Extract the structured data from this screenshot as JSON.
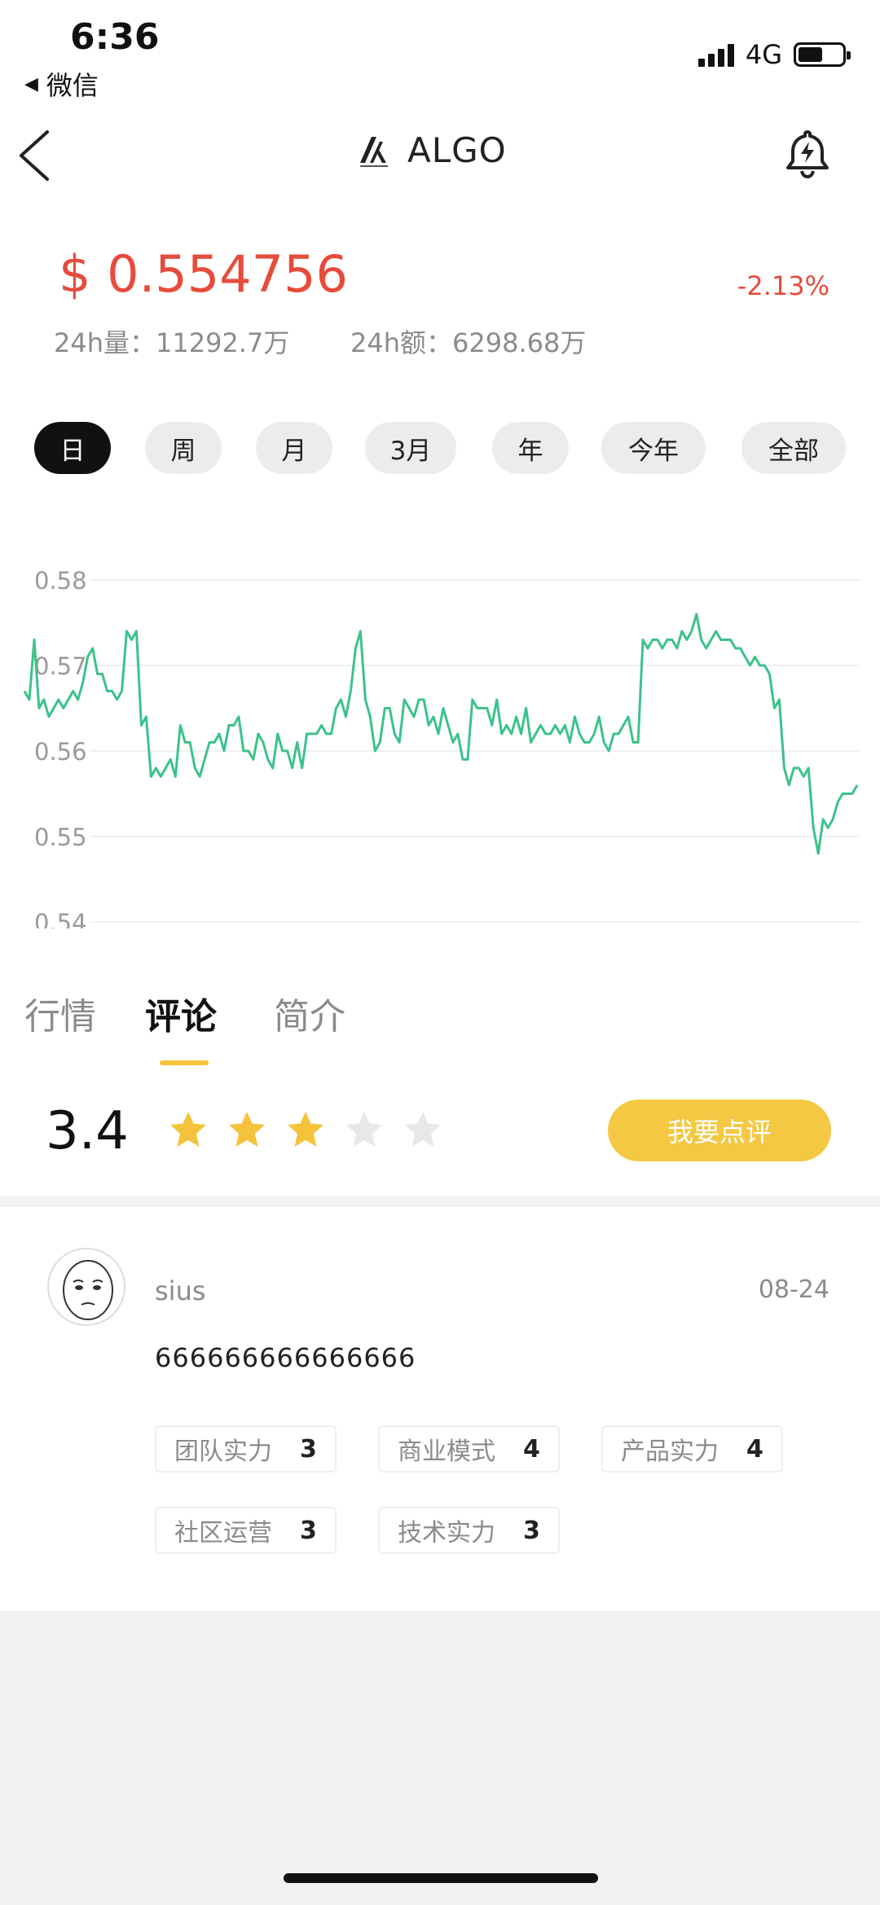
{
  "status_bar": {
    "time": "6:36",
    "back_app": "微信",
    "network": "4G"
  },
  "header": {
    "title": "ALGO",
    "back_icon": "back-chevron-icon",
    "logo_icon": "algo-logo-icon",
    "alert_icon": "bell-lightning-icon"
  },
  "price": {
    "value": "$ 0.554756",
    "change": "-2.13%",
    "volume_24h": "24h量：11292.7万",
    "amount_24h": "24h额：6298.68万",
    "color": "#e64b3c"
  },
  "ranges": [
    "日",
    "周",
    "月",
    "3月",
    "年",
    "今年",
    "全部"
  ],
  "active_range": "日",
  "chart_data": {
    "type": "line",
    "y_ticks": [
      "0.58",
      "0.57",
      "0.56",
      "0.55",
      "0.54"
    ],
    "ylim": [
      0.54,
      0.58
    ],
    "color": "#3cc28a",
    "grid": true,
    "values": [
      0.567,
      0.566,
      0.573,
      0.565,
      0.566,
      0.564,
      0.565,
      0.566,
      0.565,
      0.566,
      0.567,
      0.566,
      0.568,
      0.571,
      0.572,
      0.569,
      0.569,
      0.567,
      0.567,
      0.566,
      0.567,
      0.574,
      0.573,
      0.574,
      0.563,
      0.564,
      0.557,
      0.558,
      0.557,
      0.558,
      0.559,
      0.557,
      0.563,
      0.561,
      0.561,
      0.558,
      0.557,
      0.559,
      0.561,
      0.561,
      0.562,
      0.56,
      0.563,
      0.563,
      0.564,
      0.56,
      0.56,
      0.559,
      0.562,
      0.561,
      0.559,
      0.558,
      0.562,
      0.56,
      0.56,
      0.558,
      0.561,
      0.558,
      0.562,
      0.562,
      0.562,
      0.563,
      0.562,
      0.562,
      0.565,
      0.566,
      0.564,
      0.567,
      0.572,
      0.574,
      0.566,
      0.564,
      0.56,
      0.561,
      0.565,
      0.565,
      0.562,
      0.561,
      0.566,
      0.565,
      0.564,
      0.566,
      0.566,
      0.563,
      0.564,
      0.562,
      0.565,
      0.563,
      0.561,
      0.562,
      0.559,
      0.559,
      0.566,
      0.565,
      0.565,
      0.565,
      0.563,
      0.566,
      0.562,
      0.563,
      0.562,
      0.564,
      0.562,
      0.565,
      0.561,
      0.562,
      0.563,
      0.562,
      0.562,
      0.563,
      0.562,
      0.563,
      0.561,
      0.564,
      0.562,
      0.561,
      0.561,
      0.562,
      0.564,
      0.561,
      0.56,
      0.562,
      0.562,
      0.563,
      0.564,
      0.561,
      0.561,
      0.573,
      0.572,
      0.573,
      0.573,
      0.572,
      0.573,
      0.573,
      0.572,
      0.574,
      0.573,
      0.574,
      0.576,
      0.573,
      0.572,
      0.573,
      0.574,
      0.573,
      0.573,
      0.573,
      0.572,
      0.572,
      0.571,
      0.57,
      0.571,
      0.57,
      0.57,
      0.569,
      0.565,
      0.566,
      0.558,
      0.556,
      0.558,
      0.558,
      0.557,
      0.558,
      0.551,
      0.548,
      0.552,
      0.551,
      0.552,
      0.554,
      0.555,
      0.555,
      0.555,
      0.556
    ]
  },
  "tabs": [
    "行情",
    "评论",
    "简介"
  ],
  "active_tab": "评论",
  "rating": {
    "score": "3.4",
    "stars_filled": 3,
    "stars_total": 5,
    "button_label": "我要点评",
    "star_color": "#f5c33b"
  },
  "review": {
    "username": "sius",
    "date": "08-24",
    "text": "666666666666666",
    "tags": [
      {
        "label": "团队实力",
        "value": "3"
      },
      {
        "label": "商业模式",
        "value": "4"
      },
      {
        "label": "产品实力",
        "value": "4"
      },
      {
        "label": "社区运营",
        "value": "3"
      },
      {
        "label": "技术实力",
        "value": "3"
      }
    ]
  }
}
